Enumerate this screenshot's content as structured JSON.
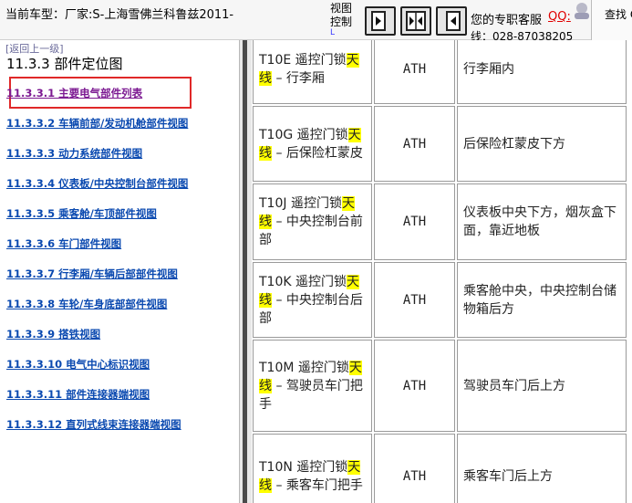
{
  "header": {
    "car_model": "当前车型：厂家:S-上海雪佛兰科鲁兹2011-",
    "view_control_label": "视图控制",
    "view_control_mini": "L",
    "buttons": [
      "right-pane-icon",
      "split-pane-icon",
      "left-pane-icon"
    ],
    "service_text": "您的专职客服",
    "qq_label": "QQ:",
    "phone": "线：028-87038205"
  },
  "find_popup": {
    "label": "查找 Q"
  },
  "nav": {
    "back_link": "[返回上一级]",
    "section_title": "11.3.3 部件定位图",
    "items": [
      {
        "label": "11.3.3.1 主要电气部件列表",
        "visited": true
      },
      {
        "label": "11.3.3.2 车辆前部/发动机舱部件视图"
      },
      {
        "label": "11.3.3.3 动力系统部件视图"
      },
      {
        "label": "11.3.3.4 仪表板/中央控制台部件视图"
      },
      {
        "label": "11.3.3.5 乘客舱/车顶部件视图"
      },
      {
        "label": "11.3.3.6 车门部件视图"
      },
      {
        "label": "11.3.3.7 行李厢/车辆后部部件视图"
      },
      {
        "label": "11.3.3.8 车轮/车身底部部件视图"
      },
      {
        "label": "11.3.3.9 搭铁视图"
      },
      {
        "label": "11.3.3.10 电气中心标识视图"
      },
      {
        "label": "11.3.3.11 部件连接器端视图"
      },
      {
        "label": "11.3.3.12 直列式线束连接器端视图"
      }
    ]
  },
  "table": {
    "rows": [
      {
        "pre": "T10E 遥控门锁",
        "hl1": "天",
        "hl2": "线",
        "post": " – 行李厢",
        "code": "ATH",
        "location": "行李厢内"
      },
      {
        "pre": "T10G 遥控门锁",
        "hl1": "天",
        "hl2": "线",
        "post": " – 后保险杠蒙皮",
        "code": "ATH",
        "location": "后保险杠蒙皮下方"
      },
      {
        "pre": "T10J 遥控门锁",
        "hl1": "天",
        "hl2": "线",
        "post": " – 中央控制台前部",
        "code": "ATH",
        "location": "仪表板中央下方，烟灰盒下面，靠近地板"
      },
      {
        "pre": "T10K 遥控门锁",
        "hl1": "天",
        "hl2": "线",
        "post": " – 中央控制台后部",
        "code": "ATH",
        "location": "乘客舱中央，中央控制台储物箱后方"
      },
      {
        "pre": "T10M 遥控门锁",
        "hl1": "天",
        "hl2": "线",
        "post": " – 驾驶员车门把手",
        "code": "ATH",
        "location": "驾驶员车门后上方"
      },
      {
        "pre": "T10N 遥控门锁",
        "hl1": "天",
        "hl2": "线",
        "post": " – 乘客车门把手",
        "code": "ATH",
        "location": "乘客车门后上方"
      }
    ]
  },
  "colors": {
    "link": "#0a49b0",
    "visited_link": "#7c1a92",
    "highlight": "#ffff00",
    "annotation_box": "#e02828",
    "qq": "#e00000"
  }
}
